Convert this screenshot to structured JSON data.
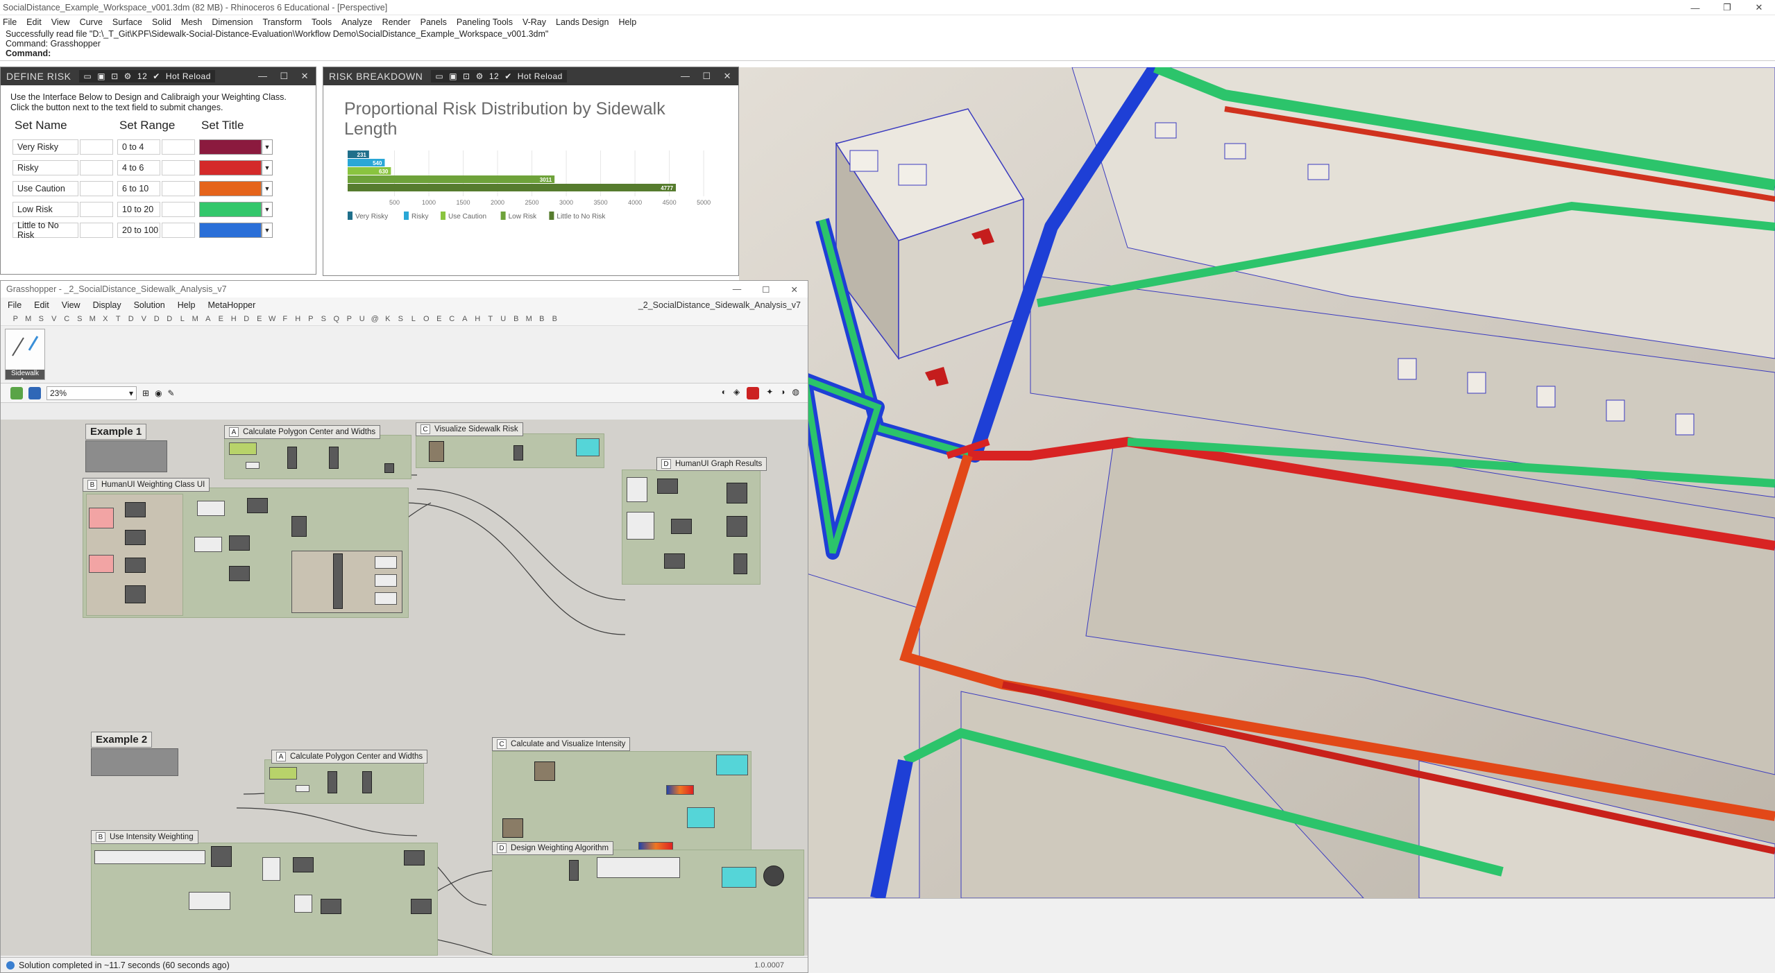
{
  "window": {
    "title": "SocialDistance_Example_Workspace_v001.3dm (82 MB) - Rhinoceros 6 Educational - [Perspective]",
    "controls": [
      "—",
      "❐",
      "✕"
    ]
  },
  "menu": [
    "File",
    "Edit",
    "View",
    "Curve",
    "Surface",
    "Solid",
    "Mesh",
    "Dimension",
    "Transform",
    "Tools",
    "Analyze",
    "Render",
    "Panels",
    "Paneling Tools",
    "V-Ray",
    "Lands Design",
    "Help"
  ],
  "command": {
    "history": [
      "Successfully read file \"D:\\_T_Git\\KPF\\Sidewalk-Social-Distance-Evaluation\\Workflow Demo\\SocialDistance_Example_Workspace_v001.3dm\"",
      "Command: Grasshopper"
    ],
    "prompt": "Command:"
  },
  "define_risk": {
    "title": "DEFINE RISK",
    "toolbar_count": "12",
    "hot_reload": "Hot Reload",
    "instructions": [
      "Use the Interface Below to Design and Calibraigh your Weighting Class.",
      "Click the button next to the text field to submit changes."
    ],
    "headers": [
      "Set Name",
      "Set Range",
      "Set Title"
    ],
    "rows": [
      {
        "name": "Very Risky",
        "range": "0 to 4",
        "color": "#8b1a3e"
      },
      {
        "name": "Risky",
        "range": "4 to 6",
        "color": "#d42a2a"
      },
      {
        "name": "Use Caution",
        "range": "6 to 10",
        "color": "#e5641b"
      },
      {
        "name": "Low Risk",
        "range": "10 to 20",
        "color": "#33c76b"
      },
      {
        "name": "Little to No Risk",
        "range": "20 to 100",
        "color": "#2a6fd8"
      }
    ]
  },
  "risk_breakdown": {
    "title": "RISK BREAKDOWN",
    "toolbar_count": "12",
    "hot_reload": "Hot Reload"
  },
  "chart_data": {
    "type": "bar",
    "title": "Proportional Risk Distribution by  Sidewalk Length",
    "categories": [
      "Very Risky",
      "Risky",
      "Use Caution",
      "Low Risk",
      "Little to No Risk"
    ],
    "values": [
      231,
      540,
      630,
      3011,
      4777
    ],
    "colors": [
      "#1f6f8b",
      "#2aa7d6",
      "#8ac43f",
      "#6ea23a",
      "#567c2e"
    ],
    "xlim": [
      0,
      5000
    ],
    "xticks": [
      500,
      1000,
      1500,
      2000,
      2500,
      3000,
      3500,
      4000,
      4500,
      5000
    ],
    "legend_position": "bottom",
    "grid": true
  },
  "grasshopper": {
    "title": "Grasshopper - _2_SocialDistance_Sidewalk_Analysis_v7",
    "menu": [
      "File",
      "Edit",
      "View",
      "Display",
      "Solution",
      "Help",
      "MetaHopper"
    ],
    "doc_name": "_2_SocialDistance_Sidewalk_Analysis_v7",
    "tabs": [
      "P",
      "M",
      "S",
      "V",
      "C",
      "S",
      "M",
      "X",
      "T",
      "D",
      "V",
      "D",
      "D",
      "L",
      "M",
      "A",
      "E",
      "H",
      "D",
      "E",
      "W",
      "F",
      "H",
      "P",
      "S",
      "Q",
      "P",
      "U",
      "@",
      "K",
      "S",
      "L",
      "O",
      "E",
      "C",
      "A",
      "H",
      "T",
      "U",
      "B",
      "M",
      "B",
      "B"
    ],
    "ribbon_label": "Sidewalk A...",
    "zoom": "23%",
    "status": "Solution completed in ~11.7 seconds (60 seconds ago)",
    "version": "1.0.0007",
    "examples": [
      "Example 1",
      "Example 2"
    ],
    "groups": [
      {
        "letter": "A",
        "title": "Calculate Polygon Center and Widths"
      },
      {
        "letter": "C",
        "title": "Visualize Sidewalk Risk"
      },
      {
        "letter": "D",
        "title": "HumanUI Graph Results"
      },
      {
        "letter": "B",
        "title": "HumanUI Weighting Class UI"
      },
      {
        "letter": "A",
        "title": "Calculate Polygon Center and Widths"
      },
      {
        "letter": "C",
        "title": "Calculate and Visualize Intensity"
      },
      {
        "letter": "B",
        "title": "Use Intensity Weighting"
      },
      {
        "letter": "D",
        "title": "Design Weighting Algorithm"
      }
    ]
  }
}
